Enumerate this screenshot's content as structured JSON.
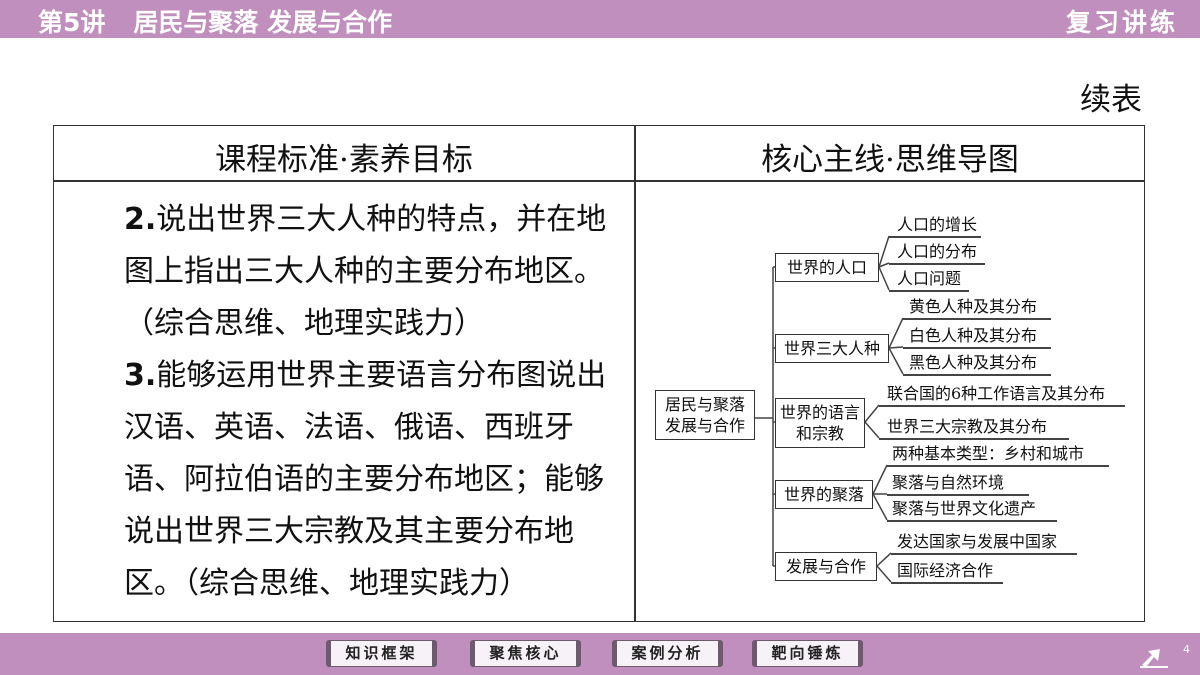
{
  "header": {
    "lesson_number": "第5讲",
    "lesson_title": "居民与聚落 发展与合作",
    "module": "复习讲练"
  },
  "continued_label": "续表",
  "table": {
    "col1_header": "课程标准·素养目标",
    "col2_header": "核心主线·思维导图",
    "standards": [
      {
        "num": "2.",
        "text": "说出世界三大人种的特点，并在地图上指出三大人种的主要分布地区。（综合思维、地理实践力）"
      },
      {
        "num": "3.",
        "text": "能够运用世界主要语言分布图说出汉语、英语、法语、俄语、西班牙语、阿拉伯语的主要分布地区；能够说出世界三大宗教及其主要分布地区。（综合思维、地理实践力）"
      }
    ]
  },
  "mindmap": {
    "root": "居民与聚落发展与合作",
    "branches": [
      {
        "label": "世界的人口",
        "leaves": [
          "人口的增长",
          "人口的分布",
          "人口问题"
        ]
      },
      {
        "label": "世界三大人种",
        "leaves": [
          "黄色人种及其分布",
          "白色人种及其分布",
          "黑色人种及其分布"
        ]
      },
      {
        "label": "世界的语言和宗教",
        "leaves": [
          "联合国的6种工作语言及其分布",
          "世界三大宗教及其分布"
        ]
      },
      {
        "label": "世界的聚落",
        "leaves": [
          "两种基本类型：乡村和城市",
          "聚落与自然环境",
          "聚落与世界文化遗产"
        ]
      },
      {
        "label": "发展与合作",
        "leaves": [
          "发达国家与发展中国家",
          "国际经济合作"
        ]
      }
    ]
  },
  "footer": {
    "nav": [
      "知识框架",
      "聚焦核心",
      "案例分析",
      "靶向锤炼"
    ],
    "page": "4"
  },
  "colors": {
    "bar": "#c08fbe",
    "button_bg": "#f7f2f7",
    "button_border": "#6d5a6c"
  }
}
